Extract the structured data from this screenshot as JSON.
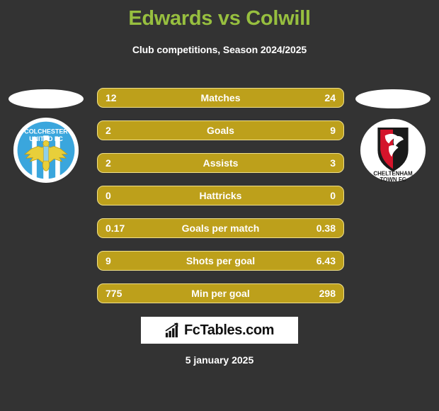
{
  "header": {
    "title": "Edwards vs Colwill",
    "subtitle": "Club competitions, Season 2024/2025",
    "title_color": "#97bf3f"
  },
  "teams": {
    "home": {
      "crest_name": "colchester-united-fc-crest",
      "crest_line1": "COLCHESTER",
      "crest_line2": "UNITED FC"
    },
    "away": {
      "crest_name": "cheltenham-town-fc-crest",
      "crest_line1": "CHELTENHAM",
      "crest_line2": "TOWN FC"
    }
  },
  "stats": {
    "bar_color": "#bda01b",
    "bar_border_color": "#f0e08a",
    "rows": [
      {
        "label": "Matches",
        "home": "12",
        "away": "24"
      },
      {
        "label": "Goals",
        "home": "2",
        "away": "9"
      },
      {
        "label": "Assists",
        "home": "2",
        "away": "3"
      },
      {
        "label": "Hattricks",
        "home": "0",
        "away": "0"
      },
      {
        "label": "Goals per match",
        "home": "0.17",
        "away": "0.38"
      },
      {
        "label": "Shots per goal",
        "home": "9",
        "away": "6.43"
      },
      {
        "label": "Min per goal",
        "home": "775",
        "away": "298"
      }
    ]
  },
  "footer": {
    "brand": "FcTables.com",
    "brand_icon": "bar-chart-icon",
    "date": "5 january 2025"
  }
}
